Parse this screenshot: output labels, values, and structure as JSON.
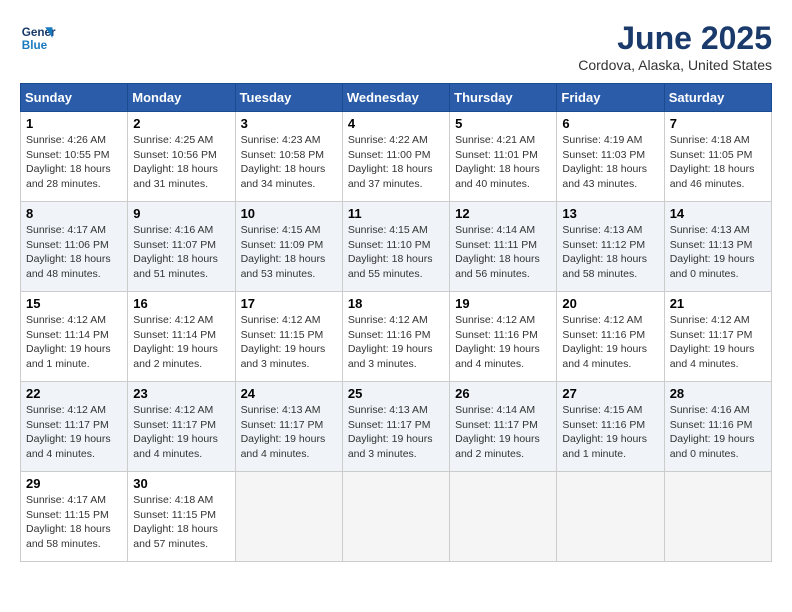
{
  "header": {
    "logo_line1": "General",
    "logo_line2": "Blue",
    "month": "June 2025",
    "location": "Cordova, Alaska, United States"
  },
  "days_of_week": [
    "Sunday",
    "Monday",
    "Tuesday",
    "Wednesday",
    "Thursday",
    "Friday",
    "Saturday"
  ],
  "weeks": [
    [
      {
        "day": "1",
        "sunrise": "4:26 AM",
        "sunset": "10:55 PM",
        "daylight": "18 hours and 28 minutes."
      },
      {
        "day": "2",
        "sunrise": "4:25 AM",
        "sunset": "10:56 PM",
        "daylight": "18 hours and 31 minutes."
      },
      {
        "day": "3",
        "sunrise": "4:23 AM",
        "sunset": "10:58 PM",
        "daylight": "18 hours and 34 minutes."
      },
      {
        "day": "4",
        "sunrise": "4:22 AM",
        "sunset": "11:00 PM",
        "daylight": "18 hours and 37 minutes."
      },
      {
        "day": "5",
        "sunrise": "4:21 AM",
        "sunset": "11:01 PM",
        "daylight": "18 hours and 40 minutes."
      },
      {
        "day": "6",
        "sunrise": "4:19 AM",
        "sunset": "11:03 PM",
        "daylight": "18 hours and 43 minutes."
      },
      {
        "day": "7",
        "sunrise": "4:18 AM",
        "sunset": "11:05 PM",
        "daylight": "18 hours and 46 minutes."
      }
    ],
    [
      {
        "day": "8",
        "sunrise": "4:17 AM",
        "sunset": "11:06 PM",
        "daylight": "18 hours and 48 minutes."
      },
      {
        "day": "9",
        "sunrise": "4:16 AM",
        "sunset": "11:07 PM",
        "daylight": "18 hours and 51 minutes."
      },
      {
        "day": "10",
        "sunrise": "4:15 AM",
        "sunset": "11:09 PM",
        "daylight": "18 hours and 53 minutes."
      },
      {
        "day": "11",
        "sunrise": "4:15 AM",
        "sunset": "11:10 PM",
        "daylight": "18 hours and 55 minutes."
      },
      {
        "day": "12",
        "sunrise": "4:14 AM",
        "sunset": "11:11 PM",
        "daylight": "18 hours and 56 minutes."
      },
      {
        "day": "13",
        "sunrise": "4:13 AM",
        "sunset": "11:12 PM",
        "daylight": "18 hours and 58 minutes."
      },
      {
        "day": "14",
        "sunrise": "4:13 AM",
        "sunset": "11:13 PM",
        "daylight": "19 hours and 0 minutes."
      }
    ],
    [
      {
        "day": "15",
        "sunrise": "4:12 AM",
        "sunset": "11:14 PM",
        "daylight": "19 hours and 1 minute."
      },
      {
        "day": "16",
        "sunrise": "4:12 AM",
        "sunset": "11:14 PM",
        "daylight": "19 hours and 2 minutes."
      },
      {
        "day": "17",
        "sunrise": "4:12 AM",
        "sunset": "11:15 PM",
        "daylight": "19 hours and 3 minutes."
      },
      {
        "day": "18",
        "sunrise": "4:12 AM",
        "sunset": "11:16 PM",
        "daylight": "19 hours and 3 minutes."
      },
      {
        "day": "19",
        "sunrise": "4:12 AM",
        "sunset": "11:16 PM",
        "daylight": "19 hours and 4 minutes."
      },
      {
        "day": "20",
        "sunrise": "4:12 AM",
        "sunset": "11:16 PM",
        "daylight": "19 hours and 4 minutes."
      },
      {
        "day": "21",
        "sunrise": "4:12 AM",
        "sunset": "11:17 PM",
        "daylight": "19 hours and 4 minutes."
      }
    ],
    [
      {
        "day": "22",
        "sunrise": "4:12 AM",
        "sunset": "11:17 PM",
        "daylight": "19 hours and 4 minutes."
      },
      {
        "day": "23",
        "sunrise": "4:12 AM",
        "sunset": "11:17 PM",
        "daylight": "19 hours and 4 minutes."
      },
      {
        "day": "24",
        "sunrise": "4:13 AM",
        "sunset": "11:17 PM",
        "daylight": "19 hours and 4 minutes."
      },
      {
        "day": "25",
        "sunrise": "4:13 AM",
        "sunset": "11:17 PM",
        "daylight": "19 hours and 3 minutes."
      },
      {
        "day": "26",
        "sunrise": "4:14 AM",
        "sunset": "11:17 PM",
        "daylight": "19 hours and 2 minutes."
      },
      {
        "day": "27",
        "sunrise": "4:15 AM",
        "sunset": "11:16 PM",
        "daylight": "19 hours and 1 minute."
      },
      {
        "day": "28",
        "sunrise": "4:16 AM",
        "sunset": "11:16 PM",
        "daylight": "19 hours and 0 minutes."
      }
    ],
    [
      {
        "day": "29",
        "sunrise": "4:17 AM",
        "sunset": "11:15 PM",
        "daylight": "18 hours and 58 minutes."
      },
      {
        "day": "30",
        "sunrise": "4:18 AM",
        "sunset": "11:15 PM",
        "daylight": "18 hours and 57 minutes."
      },
      null,
      null,
      null,
      null,
      null
    ]
  ]
}
